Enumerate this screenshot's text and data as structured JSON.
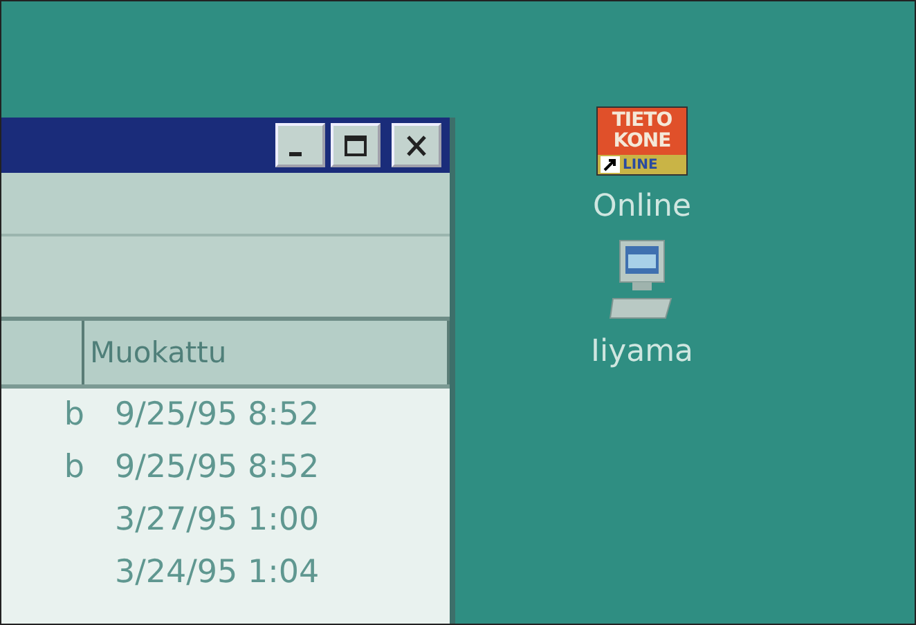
{
  "window": {
    "controls": [
      {
        "kind": "minimize"
      },
      {
        "kind": "maximize"
      },
      {
        "kind": "close"
      }
    ],
    "table": {
      "columns": [
        "",
        "Muokattu"
      ],
      "rows": [
        {
          "column_1": "b",
          "modified": "9/25/95 8:52"
        },
        {
          "column_1": "b",
          "modified": "9/25/95 8:52"
        },
        {
          "modified": "3/27/95 1:00"
        },
        {
          "modified": "3/24/95 1:04"
        }
      ]
    }
  },
  "desktop_icons": [
    {
      "kind": "logo",
      "logo_lines": [
        "TIETO",
        "KONE"
      ],
      "logo_tag": "LINE",
      "label": "Online"
    },
    {
      "kind": "computer",
      "label": "Iiyama"
    }
  ]
}
